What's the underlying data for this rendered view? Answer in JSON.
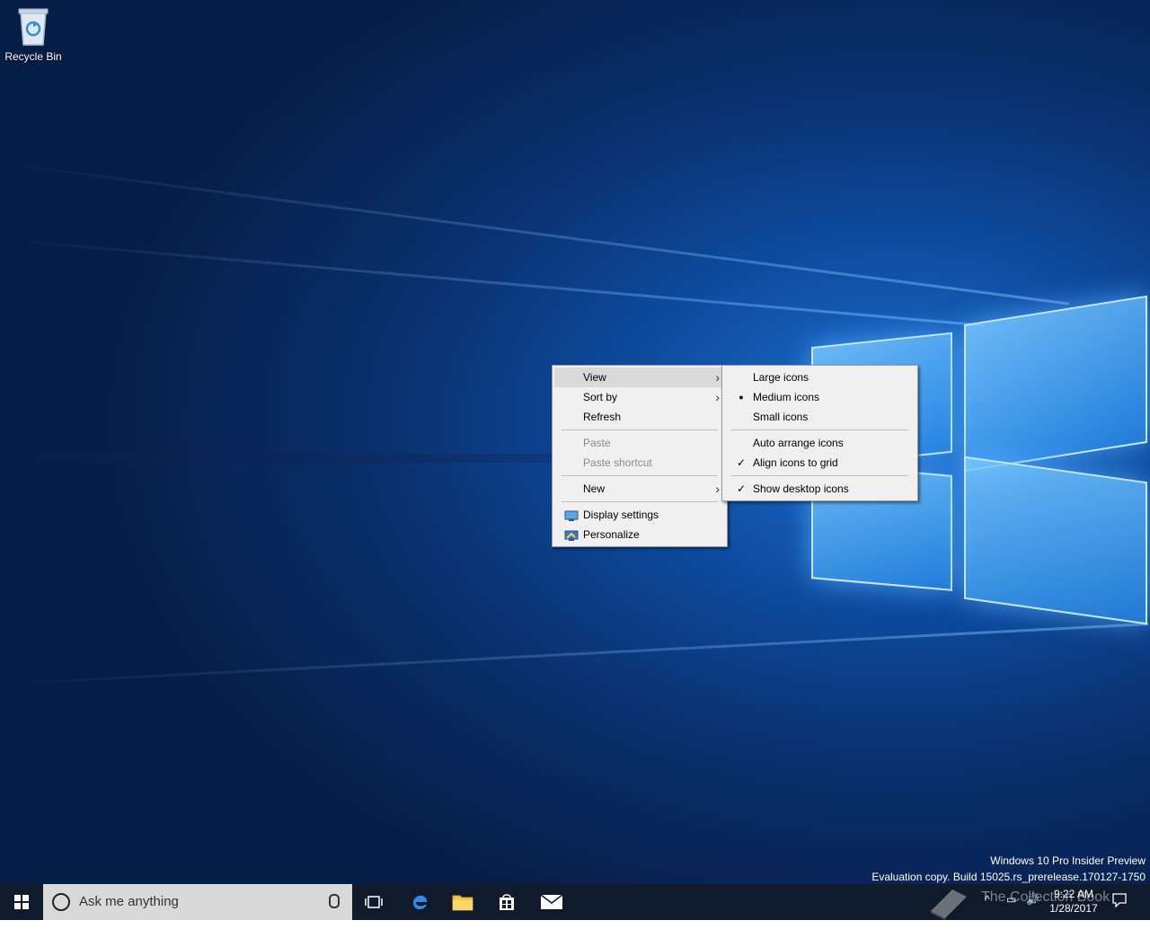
{
  "desktop": {
    "icons": [
      {
        "label": "Recycle Bin",
        "icon": "recycle-bin-icon"
      }
    ],
    "watermark": {
      "line1": "Windows 10 Pro Insider Preview",
      "line2": "Evaluation copy. Build 15025.rs_prerelease.170127-1750"
    }
  },
  "context_menu": {
    "items": {
      "view": "View",
      "sort_by": "Sort by",
      "refresh": "Refresh",
      "paste": "Paste",
      "paste_shortcut": "Paste shortcut",
      "new": "New",
      "display_settings": "Display settings",
      "personalize": "Personalize"
    }
  },
  "view_submenu": {
    "large_icons": "Large icons",
    "medium_icons": "Medium icons",
    "small_icons": "Small icons",
    "auto_arrange": "Auto arrange icons",
    "align_grid": "Align icons to grid",
    "show_desktop_icons": "Show desktop icons",
    "bullet": "●",
    "check": "✓"
  },
  "taskbar": {
    "search_placeholder": "Ask me anything",
    "clock_time": "9:22 AM",
    "clock_date": "1/28/2017",
    "watermark_text": "The Collection Book"
  },
  "colors": {
    "taskbar": "#0f1a2a",
    "menu_bg": "#f0f0f0",
    "hover": "#d9d9d9",
    "accent": "#0078d7"
  }
}
